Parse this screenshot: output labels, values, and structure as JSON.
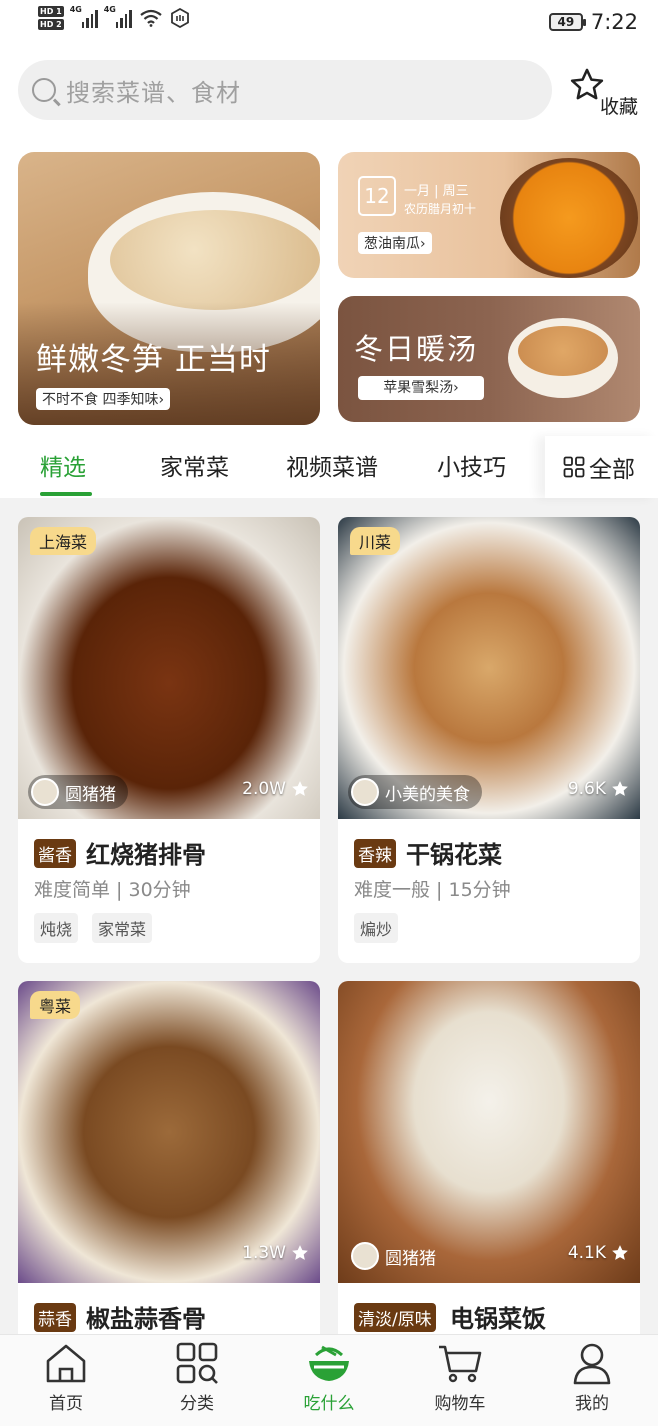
{
  "status_bar": {
    "hd1": "HD 1",
    "hd2": "HD 2",
    "net1": "4G",
    "net2": "4G",
    "battery": "49",
    "time": "7:22"
  },
  "search": {
    "placeholder": "搜索菜谱、食材"
  },
  "favorites": {
    "label": "收藏"
  },
  "banners": {
    "main": {
      "title": "鲜嫩冬笋 正当时",
      "subtitle": "不时不食 四季知味›"
    },
    "calendar": {
      "day": "12",
      "line1": "一月 | 周三",
      "line2": "农历腊月初十",
      "tag": "葱油南瓜›"
    },
    "soup": {
      "title": "冬日暖汤",
      "tag": "苹果雪梨汤›"
    }
  },
  "tabs": [
    {
      "label": "精选",
      "active": true
    },
    {
      "label": "家常菜"
    },
    {
      "label": "视频菜谱"
    },
    {
      "label": "小技巧"
    }
  ],
  "tab_all": "全部",
  "cards": [
    {
      "region": "上海菜",
      "author": "圆猪猪",
      "likes": "2.0W",
      "flavor": "酱香",
      "name": "红烧猪排骨",
      "meta": "难度简单 | 30分钟",
      "tags": [
        "炖烧",
        "家常菜"
      ]
    },
    {
      "region": "川菜",
      "author": "小美的美食",
      "likes": "9.6K",
      "flavor": "香辣",
      "name": "干锅花菜",
      "meta": "难度一般 | 15分钟",
      "tags": [
        "煸炒"
      ]
    },
    {
      "region": "粤菜",
      "likes": "1.3W",
      "flavor": "蒜香",
      "name": "椒盐蒜香骨"
    },
    {
      "author": "圆猪猪",
      "likes": "4.1K",
      "flavor": "清淡/原味",
      "name": "电锅菜饭"
    }
  ],
  "nav": [
    {
      "label": "首页",
      "icon": "home-icon"
    },
    {
      "label": "分类",
      "icon": "category-icon"
    },
    {
      "label": "吃什么",
      "icon": "bowl-icon",
      "active": true
    },
    {
      "label": "购物车",
      "icon": "cart-icon"
    },
    {
      "label": "我的",
      "icon": "user-icon"
    }
  ],
  "colors": {
    "accent": "#2aa136",
    "region_badge": "#f7d98c",
    "flavor_badge": "#6a3a12"
  }
}
